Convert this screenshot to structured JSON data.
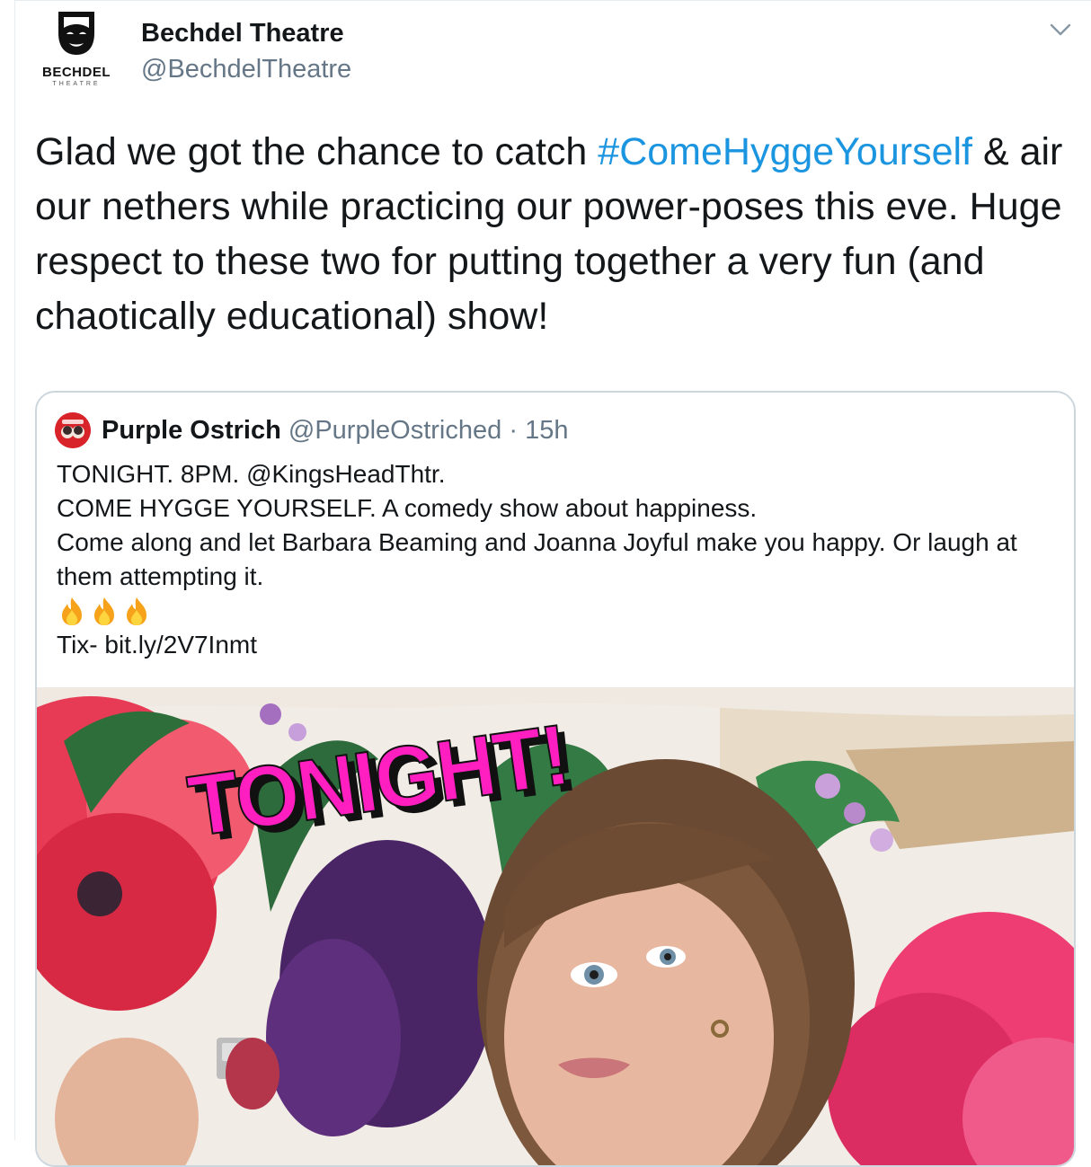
{
  "tweet": {
    "author": {
      "display_name": "Bechdel Theatre",
      "handle": "@BechdelTheatre",
      "avatar_icon": "theatre-mask-logo-icon",
      "avatar_wordmark": "BECHDEL",
      "avatar_subword": "THEATRE"
    },
    "menu_icon": "chevron-down-icon",
    "text": {
      "before": "Glad we got the chance to catch ",
      "hashtag": "#ComeHyggeYourself",
      "after": " & air our nethers while practicing our power-poses this eve. Huge respect to these two for putting together a very fun (and chaotically educational) show!"
    },
    "link_color": "#1b95e0"
  },
  "quoted_tweet": {
    "author": {
      "display_name": "Purple Ostrich",
      "handle": "@PurpleOstriched",
      "separator": "·",
      "time": "15h",
      "avatar_icon": "purple-ostrich-avatar-icon"
    },
    "lines": [
      "TONIGHT. 8PM. @KingsHeadThtr.",
      "COME HYGGE YOURSELF. A comedy show about happiness.",
      "Come along and let Barbara Beaming and Joanna Joyful make you happy. Or laugh at them attempting it."
    ],
    "emoji": [
      "fire-emoji-icon",
      "fire-emoji-icon",
      "fire-emoji-icon"
    ],
    "tickets": "Tix- bit.ly/2V7Inmt",
    "media": {
      "description_icon": "promo-photo-image",
      "overlay_text": "TONIGHT!",
      "overlay_color": "#ff1fc0"
    }
  }
}
